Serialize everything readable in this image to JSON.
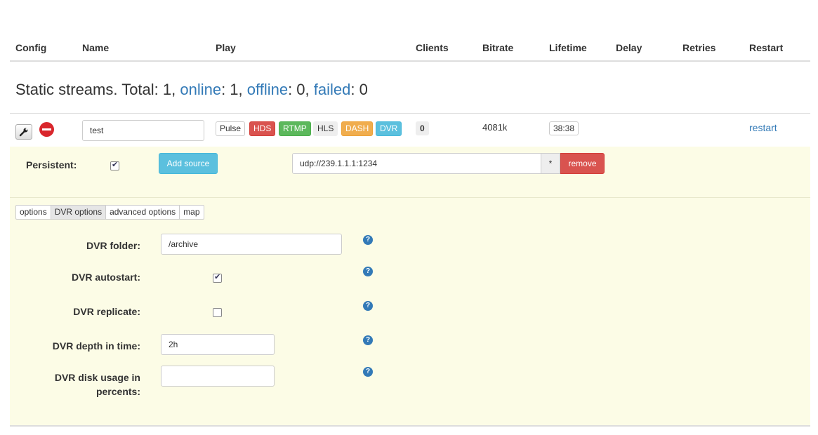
{
  "table_header": {
    "config": "Config",
    "name": "Name",
    "play": "Play",
    "clients": "Clients",
    "bitrate": "Bitrate",
    "lifetime": "Lifetime",
    "delay": "Delay",
    "retries": "Retries",
    "restart": "Restart"
  },
  "summary": {
    "prefix": "Static streams. Total: 1, ",
    "online_label": "online",
    "online_value": ": 1, ",
    "offline_label": "offline",
    "offline_value": ": 0, ",
    "failed_label": "failed",
    "failed_value": ": 0"
  },
  "stream": {
    "config_icon": "wrench-icon",
    "delete_icon": "minus-circle-icon",
    "name_value": "test",
    "play_badges": [
      "Pulse",
      "HDS",
      "RTMP",
      "HLS",
      "DASH",
      "DVR"
    ],
    "clients": "0",
    "bitrate": "4081k",
    "lifetime": "38:38",
    "restart_link": "restart"
  },
  "source_panel": {
    "persistent_label": "Persistent:",
    "persistent_checked": true,
    "add_source_label": "Add source",
    "source_url": "udp://239.1.1.1:1234",
    "star_label": "*",
    "remove_label": "remove"
  },
  "tabs": [
    {
      "label": "options",
      "active": false
    },
    {
      "label": "DVR options",
      "active": true
    },
    {
      "label": "advanced options",
      "active": false
    },
    {
      "label": "map",
      "active": false
    }
  ],
  "dvr": {
    "folder_label": "DVR folder:",
    "folder_value": "/archive",
    "autostart_label": "DVR autostart:",
    "autostart_checked": true,
    "replicate_label": "DVR replicate:",
    "replicate_checked": false,
    "depth_label": "DVR depth in time:",
    "depth_value": "2h",
    "disk_usage_label_1": "DVR disk usage in",
    "disk_usage_label_2": "percents:",
    "disk_usage_value": "",
    "help_glyph": "?"
  },
  "colors": {
    "link": "#337ab7",
    "panel_bg": "#fcfce6",
    "danger": "#d9534f",
    "info": "#5bc0de",
    "success": "#5cb85c",
    "warning": "#f0ad4e"
  }
}
